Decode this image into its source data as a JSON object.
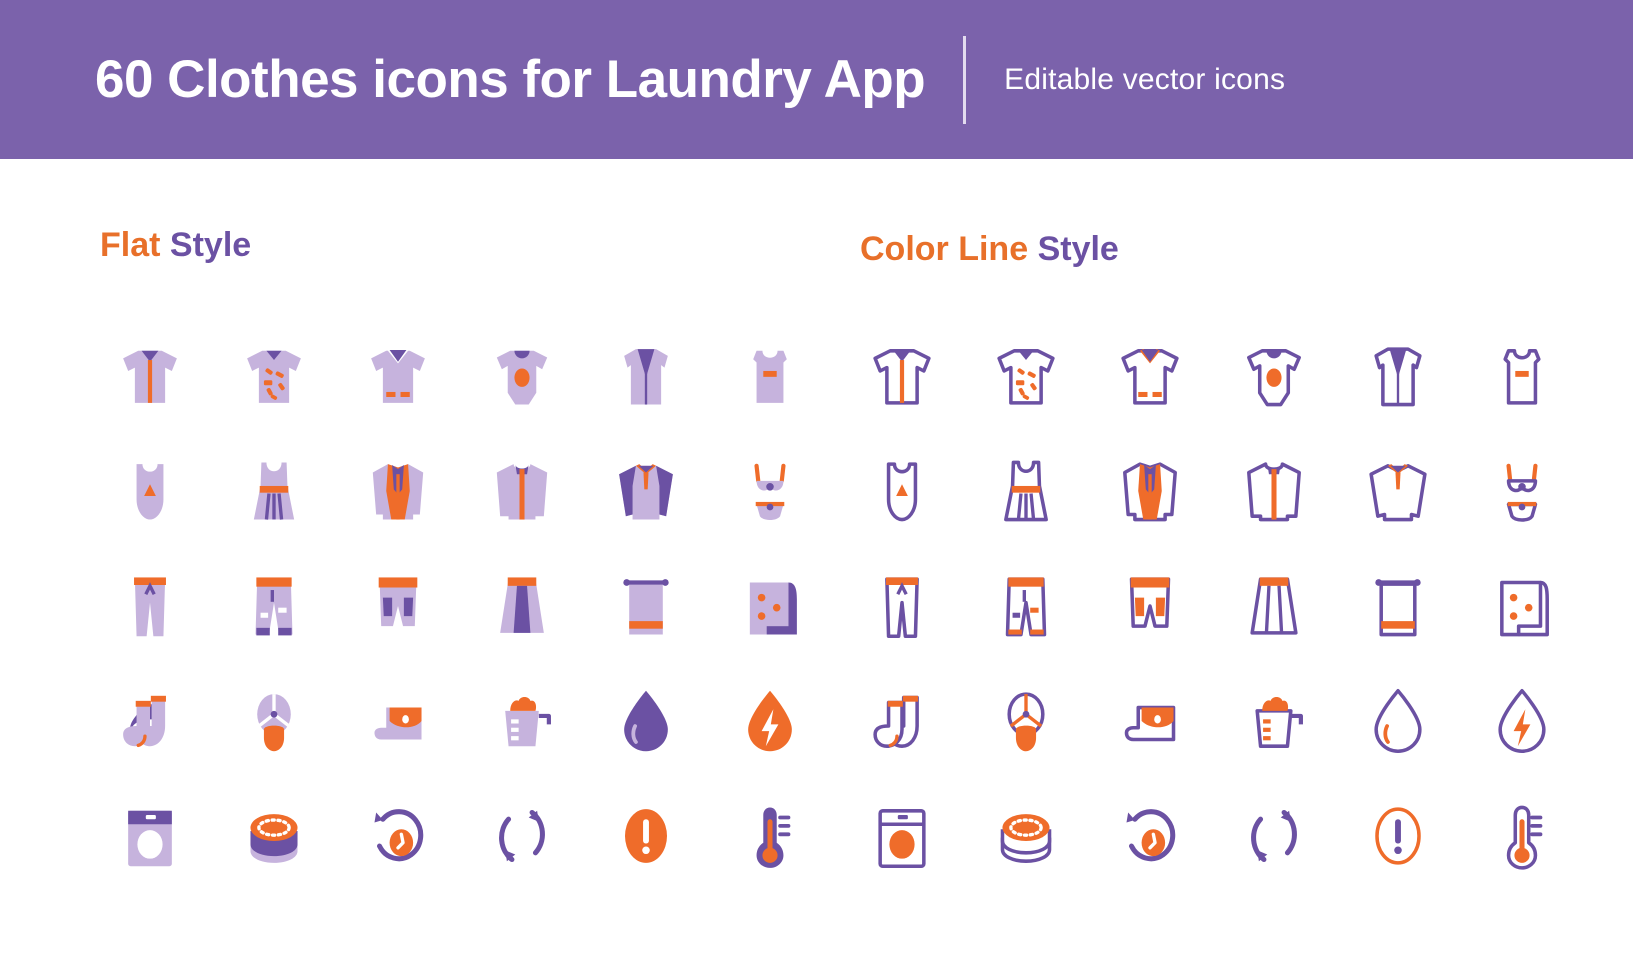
{
  "header": {
    "title": "60 Clothes icons for Laundry App",
    "subtitle": "Editable vector icons",
    "bg_color": "#7b62ab",
    "text_color": "#ffffff"
  },
  "palette": {
    "purple_dark": "#6b51a3",
    "purple_light": "#c6b3dd",
    "orange": "#ef6c2a",
    "white": "#ffffff",
    "header_purple": "#7b62ab"
  },
  "sections": [
    {
      "id": "flat",
      "title_part_1": "Flat ",
      "title_part_2": "Style",
      "title_part_1_color": "#e8702a",
      "title_part_2_color": "#6b51a3",
      "style": "flat",
      "icons": [
        {
          "name": "t-shirt-icon",
          "label": "T-shirt"
        },
        {
          "name": "dirty-shirt-icon",
          "label": "Dirty shirt"
        },
        {
          "name": "polo-shirt-icon",
          "label": "Polo shirt"
        },
        {
          "name": "baby-onesie-icon",
          "label": "Baby onesie"
        },
        {
          "name": "vest-icon",
          "label": "Vest"
        },
        {
          "name": "tank-top-icon",
          "label": "Tank top"
        },
        {
          "name": "swimsuit-icon",
          "label": "Swimsuit"
        },
        {
          "name": "dress-icon",
          "label": "Dress"
        },
        {
          "name": "blazer-icon",
          "label": "Blazer"
        },
        {
          "name": "jacket-icon",
          "label": "Jacket"
        },
        {
          "name": "sweater-icon",
          "label": "Sweater"
        },
        {
          "name": "bikini-icon",
          "label": "Bikini"
        },
        {
          "name": "pants-icon",
          "label": "Pants"
        },
        {
          "name": "cargo-pants-icon",
          "label": "Cargo pants"
        },
        {
          "name": "shorts-icon",
          "label": "Shorts"
        },
        {
          "name": "skirt-icon",
          "label": "Skirt"
        },
        {
          "name": "towel-icon",
          "label": "Towel"
        },
        {
          "name": "blanket-icon",
          "label": "Blanket"
        },
        {
          "name": "socks-icon",
          "label": "Socks"
        },
        {
          "name": "clothes-peg-icon",
          "label": "Clothes peg"
        },
        {
          "name": "detergent-box-icon",
          "label": "Detergent box"
        },
        {
          "name": "measuring-cup-icon",
          "label": "Measuring cup"
        },
        {
          "name": "water-drop-icon",
          "label": "Water drop"
        },
        {
          "name": "energy-drop-icon",
          "label": "Energy drop"
        },
        {
          "name": "washing-machine-icon",
          "label": "Washing machine"
        },
        {
          "name": "detergent-pod-icon",
          "label": "Detergent pod"
        },
        {
          "name": "timer-icon",
          "label": "Timer"
        },
        {
          "name": "refresh-cycle-icon",
          "label": "Refresh cycle"
        },
        {
          "name": "warning-icon",
          "label": "Warning"
        },
        {
          "name": "thermometer-icon",
          "label": "Thermometer"
        }
      ]
    },
    {
      "id": "line",
      "title_part_1": "Color Line ",
      "title_part_2": "Style",
      "title_part_1_color": "#e8702a",
      "title_part_2_color": "#6b51a3",
      "style": "line",
      "icons": [
        {
          "name": "t-shirt-icon",
          "label": "T-shirt"
        },
        {
          "name": "dirty-shirt-icon",
          "label": "Dirty shirt"
        },
        {
          "name": "polo-shirt-icon",
          "label": "Polo shirt"
        },
        {
          "name": "baby-onesie-icon",
          "label": "Baby onesie"
        },
        {
          "name": "vest-icon",
          "label": "Vest"
        },
        {
          "name": "tank-top-icon",
          "label": "Tank top"
        },
        {
          "name": "swimsuit-icon",
          "label": "Swimsuit"
        },
        {
          "name": "dress-icon",
          "label": "Dress"
        },
        {
          "name": "blazer-icon",
          "label": "Blazer"
        },
        {
          "name": "jacket-icon",
          "label": "Jacket"
        },
        {
          "name": "sweater-icon",
          "label": "Sweater"
        },
        {
          "name": "bikini-icon",
          "label": "Bikini"
        },
        {
          "name": "pants-icon",
          "label": "Pants"
        },
        {
          "name": "cargo-pants-icon",
          "label": "Cargo pants"
        },
        {
          "name": "shorts-icon",
          "label": "Shorts"
        },
        {
          "name": "skirt-icon",
          "label": "Skirt"
        },
        {
          "name": "towel-icon",
          "label": "Towel"
        },
        {
          "name": "blanket-icon",
          "label": "Blanket"
        },
        {
          "name": "socks-icon",
          "label": "Socks"
        },
        {
          "name": "clothes-peg-icon",
          "label": "Clothes peg"
        },
        {
          "name": "detergent-box-icon",
          "label": "Detergent box"
        },
        {
          "name": "measuring-cup-icon",
          "label": "Measuring cup"
        },
        {
          "name": "water-drop-icon",
          "label": "Water drop"
        },
        {
          "name": "energy-drop-icon",
          "label": "Energy drop"
        },
        {
          "name": "washing-machine-icon",
          "label": "Washing machine"
        },
        {
          "name": "detergent-pod-icon",
          "label": "Detergent pod"
        },
        {
          "name": "timer-icon",
          "label": "Timer"
        },
        {
          "name": "refresh-cycle-icon",
          "label": "Refresh cycle"
        },
        {
          "name": "warning-icon",
          "label": "Warning"
        },
        {
          "name": "thermometer-icon",
          "label": "Thermometer"
        }
      ]
    }
  ]
}
